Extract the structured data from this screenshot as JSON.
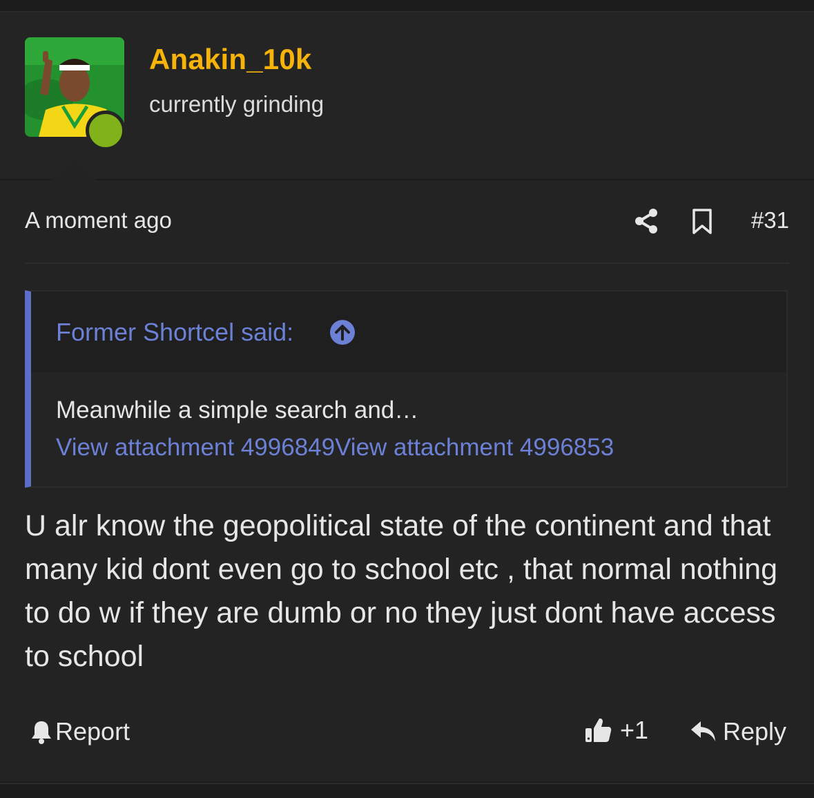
{
  "user": {
    "username": "Anakin_10k",
    "title": "currently grinding",
    "status_color": "#82b21a"
  },
  "meta": {
    "timestamp": "A moment ago",
    "post_number": "#31",
    "share_icon": "share-icon",
    "bookmark_icon": "bookmark-icon"
  },
  "quote": {
    "author_label": "Former Shortcel said:",
    "text": "Meanwhile a simple search and…",
    "attachments": [
      "View attachment 4996849",
      "View attachment 4996853"
    ]
  },
  "post": {
    "body": "U alr know the geopolitical state of the continent and that many kid dont even go to school etc , that normal nothing to do w if they are dumb or no they just dont have access to school"
  },
  "actions": {
    "report_label": "Report",
    "like_count": "+1",
    "reply_label": "Reply"
  },
  "colors": {
    "username": "#f6b30c",
    "link": "#6c80d6",
    "quote_bar": "#5b6fc9",
    "background": "#232323"
  }
}
